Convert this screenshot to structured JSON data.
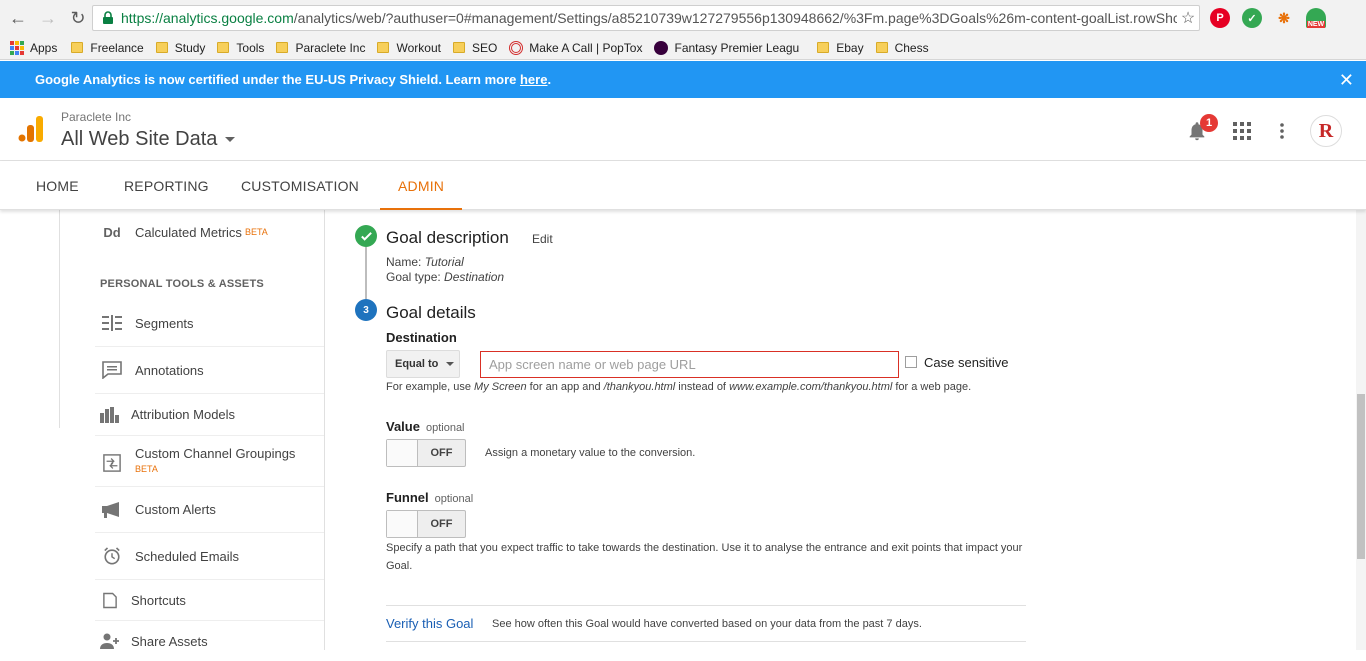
{
  "browser": {
    "url_scheme_host": "https://analytics.google.com",
    "url_path": "/analytics/web/?authuser=0#management/Settings/a85210739w127279556p130948662/%3Fm.page%3DGoals%26m-content-goalList.rowShc",
    "bookmarks": [
      "Apps",
      "Freelance",
      "Study",
      "Tools",
      "Paraclete Inc",
      "Workout",
      "SEO",
      "Make A Call | PopTox",
      "Fantasy Premier Leagu",
      "Ebay",
      "Chess"
    ],
    "ext_new_label": "NEW"
  },
  "banner": {
    "text": "Google Analytics is now certified under the EU-US Privacy Shield. Learn more ",
    "link": "here",
    "suffix": "."
  },
  "header": {
    "account": "Paraclete Inc",
    "property": "All Web Site Data",
    "notification_count": "1",
    "avatar_letter": "R"
  },
  "tabs": [
    "HOME",
    "REPORTING",
    "CUSTOMISATION",
    "ADMIN"
  ],
  "leftnav": {
    "calc_metrics_abbr": "Dd",
    "calc_metrics": "Calculated Metrics",
    "beta": "BETA",
    "section": "PERSONAL TOOLS & ASSETS",
    "items": [
      "Segments",
      "Annotations",
      "Attribution Models",
      "Custom Channel Groupings",
      "Custom Alerts",
      "Scheduled Emails",
      "Shortcuts",
      "Share Assets"
    ]
  },
  "goal_description": {
    "title": "Goal description",
    "edit": "Edit",
    "name_label": "Name:",
    "name_value": "Tutorial",
    "type_label": "Goal type:",
    "type_value": "Destination"
  },
  "goal_details": {
    "step": "3",
    "title": "Goal details",
    "destination_label": "Destination",
    "match_type": "Equal to",
    "url_placeholder": "App screen name or web page URL",
    "case_sensitive": "Case sensitive",
    "hint_1": "For example, use ",
    "hint_my_screen": "My Screen",
    "hint_2": " for an app and ",
    "hint_thankyou": "/thankyou.html",
    "hint_3": " instead of ",
    "hint_example": "www.example.com/thankyou.html",
    "hint_4": " for a web page.",
    "value_label": "Value",
    "optional": "optional",
    "off": "OFF",
    "value_desc": "Assign a monetary value to the conversion.",
    "funnel_label": "Funnel",
    "funnel_desc_1": "Specify a path that you expect traffic to take towards the destination. Use it to analyse the entrance and exit points that impact your",
    "funnel_desc_2": "Goal.",
    "verify_link": "Verify this Goal",
    "verify_desc": "See how often this Goal would have converted based on your data from the past 7 days."
  },
  "colors": {
    "banner": "#2196f3",
    "accent": "#e8710a",
    "success": "#34a853",
    "step": "#1e73be",
    "error": "#d93025"
  }
}
